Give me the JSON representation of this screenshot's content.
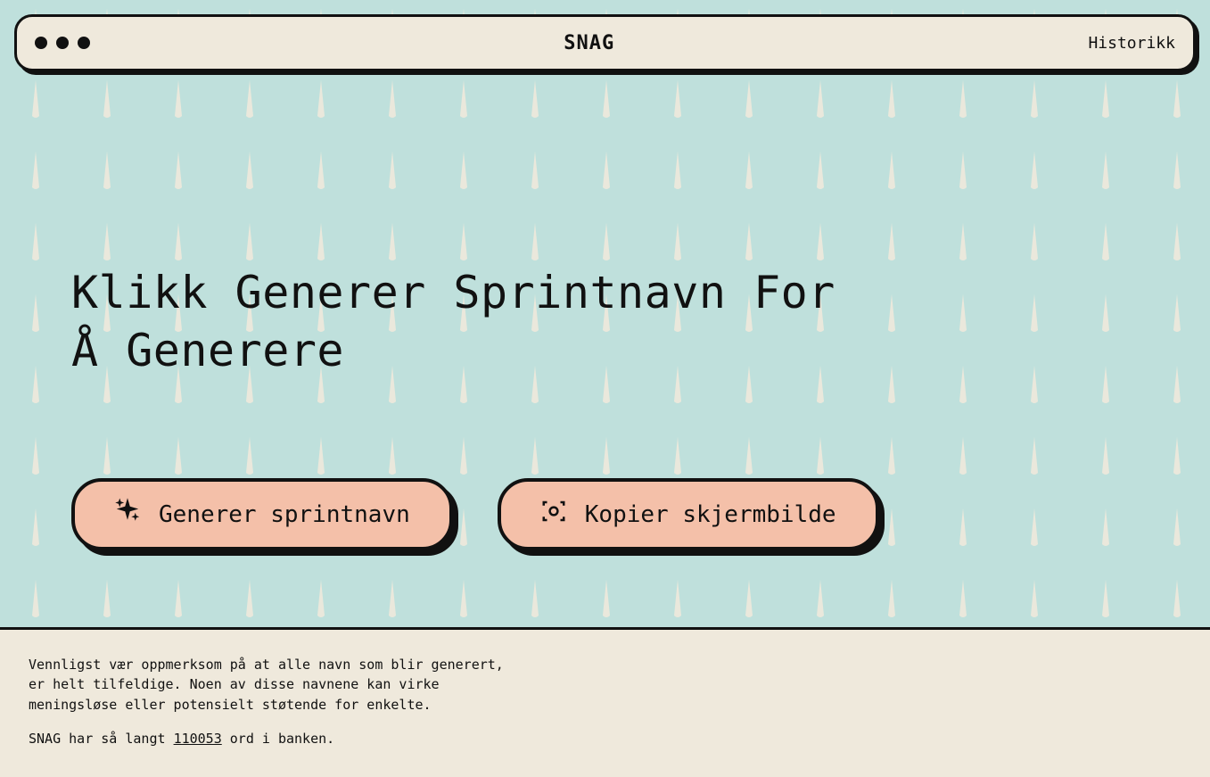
{
  "header": {
    "title": "SNAG",
    "history_link": "Historikk"
  },
  "main": {
    "headline": "Klikk Generer Sprintnavn For Å Generere",
    "buttons": {
      "generate": "Generer sprintnavn",
      "copy": "Kopier skjermbilde"
    }
  },
  "footer": {
    "disclaimer": "Vennligst vær oppmerksom på at alle navn som blir generert, er helt tilfeldige. Noen av disse navnene kan virke meningsløse eller potensielt støtende for enkelte.",
    "wordcount_prefix": "SNAG har så langt ",
    "wordcount_value": "110053",
    "wordcount_suffix": " ord i banken."
  }
}
